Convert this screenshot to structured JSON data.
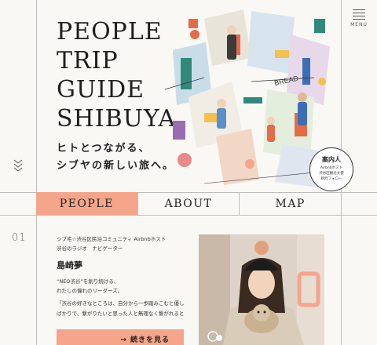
{
  "site": {
    "title_lines": [
      "PEOPLE",
      "TRIP",
      "GUIDE",
      "SHIBUYA"
    ],
    "tagline_lines": [
      "ヒトとつながる、",
      "シブヤの新しい旅へ。"
    ]
  },
  "menu": {
    "label": "MENU"
  },
  "badge": {
    "title": "案内人",
    "lines": [
      "Airbnbホスト",
      "渋谷区観光大使",
      "熱烈フォロー"
    ]
  },
  "nav": {
    "items": [
      {
        "label": "PEOPLE",
        "active": true
      },
      {
        "label": "ABOUT",
        "active": false
      },
      {
        "label": "MAP",
        "active": false
      }
    ]
  },
  "person": {
    "number": "01",
    "role_lines": [
      "シブ宅☆渋谷区民泊コミュニティ Airbnbホスト",
      "渋谷のラジオ　ナビゲーター"
    ],
    "name": "島崎夢",
    "catch_lines": [
      "“NEO渋谷”を創り続ける、",
      "わたしの憧れのリーダーズ。"
    ],
    "quote_lines": [
      "「渋谷の好きなところは、自分から一歩踏みこむと優しい人",
      "ばかりで、繋がりたいと思った人と無理なく繋がれるとこ…"
    ],
    "more_label": "→ 続きを見る"
  },
  "colors": {
    "accent": "#f4a58a",
    "line": "#bdbdbd",
    "bg": "#faf8f4"
  }
}
